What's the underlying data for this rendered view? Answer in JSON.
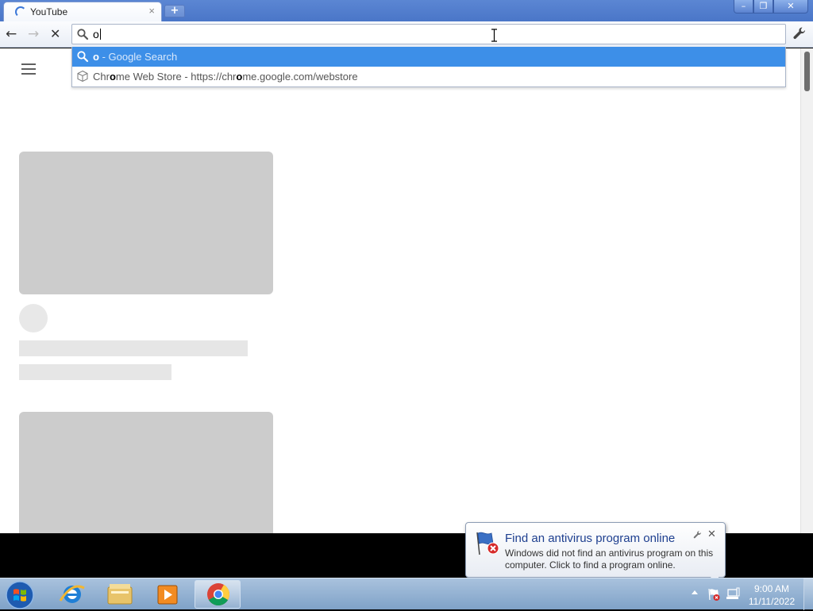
{
  "tab": {
    "title": "YouTube",
    "close": "×",
    "new_tab": "+"
  },
  "window": {
    "minimize": "–",
    "maximize": "❐",
    "close": "✕"
  },
  "toolbar": {
    "back": "←",
    "forward": "→",
    "stop": "✕"
  },
  "omnibox": {
    "text": "o"
  },
  "suggestions": [
    {
      "query": "o",
      "desc": " - Google Search",
      "icon": "search-icon"
    },
    {
      "pre": "Chr",
      "match": "o",
      "mid": "me Web Store - https://chr",
      "match2": "o",
      "post": "me.google.com/webstore",
      "icon": "webstore-icon"
    }
  ],
  "notification": {
    "title": "Find an antivirus program online",
    "body": "Windows did not find an antivirus program on this computer. Click to find a program online.",
    "close": "✕"
  },
  "taskbar": {
    "items": [
      "internet-explorer-icon",
      "windows-explorer-icon",
      "media-player-icon",
      "chrome-icon"
    ],
    "clock_time": "9:00 AM",
    "clock_date": "11/11/2022"
  },
  "colors": {
    "selection": "#3d8fe8",
    "placeholder": "#cccccc",
    "taskbar": "#7fa2c8"
  }
}
